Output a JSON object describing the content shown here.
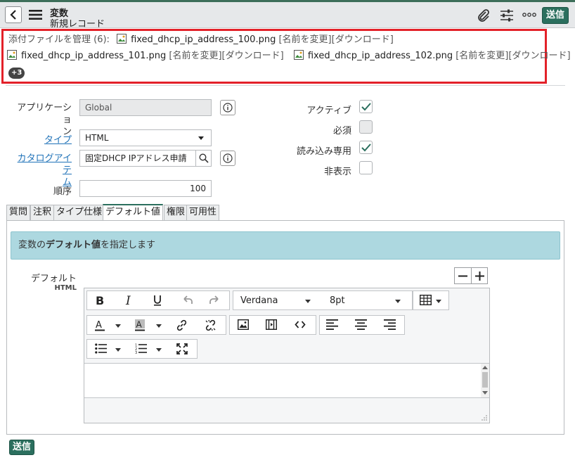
{
  "header": {
    "title": "変数",
    "subtitle": "新規レコード",
    "submit_label": "送信"
  },
  "attachments": {
    "manage_label": "添付ファイルを管理 (6):",
    "rename_label": "[名前を変更]",
    "download_label": "[ダウンロード]",
    "files": [
      "fixed_dhcp_ip_address_100.png",
      "fixed_dhcp_ip_address_101.png",
      "fixed_dhcp_ip_address_102.png"
    ],
    "more_badge": "+3"
  },
  "form": {
    "application_label_1": "アプリケーショ",
    "application_label_2": "ン",
    "application_value": "Global",
    "type_label": "タイプ",
    "type_value": "HTML",
    "catalog_label_1": "カタログアイテ",
    "catalog_label_2": "ム",
    "catalog_value": "固定DHCP IPアドレス申請",
    "order_label": "順序",
    "order_value": "100",
    "active_label": "アクティブ",
    "active_checked": true,
    "mandatory_label": "必須",
    "mandatory_checked": false,
    "readonly_label": "読み込み専用",
    "readonly_checked": true,
    "hidden_label": "非表示",
    "hidden_checked": false
  },
  "tabs": [
    "質問",
    "注釈",
    "タイプ仕様",
    "デフォルト値",
    "権限",
    "可用性"
  ],
  "active_tab": "デフォルト値",
  "panel": {
    "info_prefix": "変数の",
    "info_bold": "デフォルト値",
    "info_suffix": "を指定します",
    "default_label": "デフォルト",
    "default_sub": "HTML",
    "font_value": "Verdana",
    "size_value": "8pt"
  },
  "footer": {
    "submit_label": "送信"
  },
  "colors": {
    "accent": "#2b6f5e",
    "highlight": "#e32129",
    "banner": "#add8e0",
    "link": "#1f72b8"
  }
}
